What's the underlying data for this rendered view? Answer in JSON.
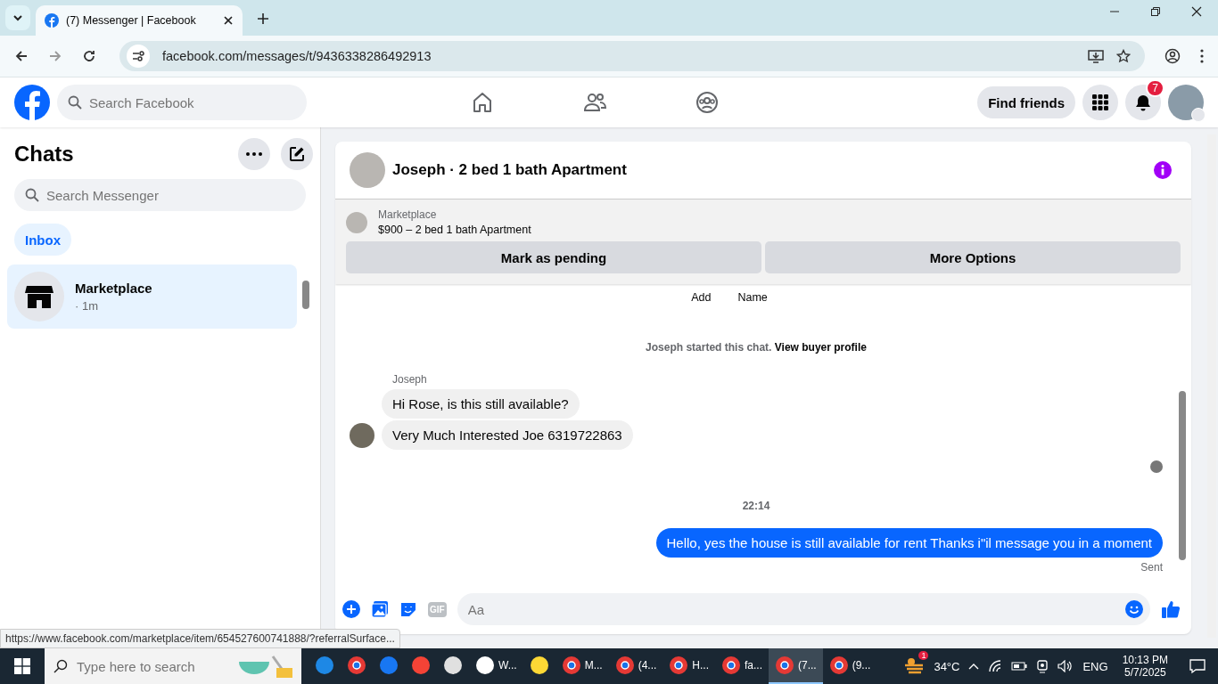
{
  "browser": {
    "tab_title": "(7) Messenger | Facebook",
    "url": "facebook.com/messages/t/9436338286492913",
    "status_url": "https://www.facebook.com/marketplace/item/654527600741888/?referralSurface..."
  },
  "header": {
    "search_placeholder": "Search Facebook",
    "find_friends": "Find friends",
    "notification_count": "7"
  },
  "sidebar": {
    "title": "Chats",
    "search_placeholder": "Search Messenger",
    "filters": [
      {
        "label": "Inbox",
        "selected": true
      }
    ],
    "chats": [
      {
        "name": "Marketplace",
        "time": "· 1m",
        "selected": true
      }
    ]
  },
  "chat": {
    "title": "Joseph · 2 bed 1 bath Apartment",
    "listing_source": "Marketplace",
    "listing_title": "$900 – 2 bed 1 bath Apartment",
    "actions": [
      "Mark as pending",
      "More Options"
    ],
    "quick_actions": [
      "Add",
      "Name"
    ],
    "system_text": "Joseph started this chat.",
    "system_link": "View buyer profile",
    "sender": "Joseph",
    "incoming": [
      "Hi Rose, is this still available?",
      "Very Much Interested Joe 6319722863"
    ],
    "timestamp": "22:14",
    "outgoing": [
      "Hello, yes the house is still available for rent Thanks i\"il message you in a moment"
    ],
    "status": "Sent",
    "composer_placeholder": "Aa",
    "gif_label": "GIF"
  },
  "taskbar": {
    "search_placeholder": "Type here to search",
    "apps": [
      {
        "kind": "edge",
        "selected": false
      },
      {
        "kind": "chrome",
        "selected": false
      },
      {
        "kind": "facebook",
        "selected": false
      },
      {
        "kind": "red",
        "selected": false
      },
      {
        "kind": "paint",
        "selected": false
      },
      {
        "kind": "whatsapp",
        "label": "W...",
        "selected": false
      },
      {
        "kind": "notes",
        "selected": false
      },
      {
        "kind": "chrome",
        "label": "M...",
        "selected": false
      },
      {
        "kind": "chrome",
        "label": "(4...",
        "selected": false
      },
      {
        "kind": "chrome",
        "label": "H...",
        "selected": false
      },
      {
        "kind": "chrome",
        "label": "fa...",
        "selected": false
      },
      {
        "kind": "chrome",
        "label": "(7...",
        "selected": true
      },
      {
        "kind": "chrome",
        "label": "(9...",
        "selected": false
      }
    ],
    "weather_badge": "1",
    "temperature": "34°C",
    "language": "ENG",
    "time": "10:13 PM",
    "date": "5/7/2025"
  }
}
